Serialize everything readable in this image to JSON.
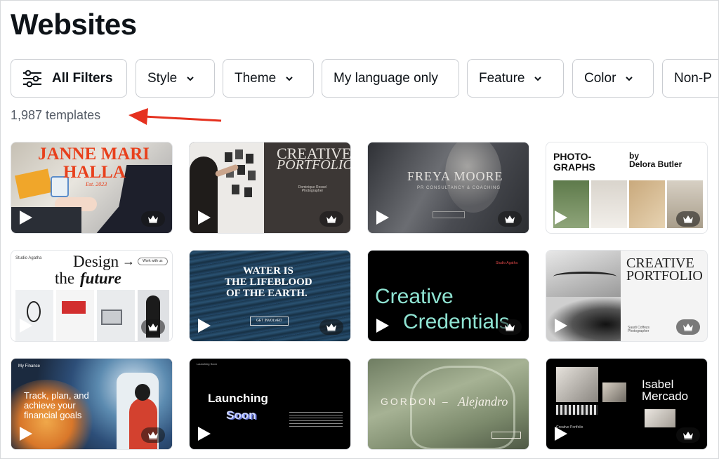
{
  "page": {
    "title": "Websites"
  },
  "filters": {
    "all": "All Filters",
    "style": "Style",
    "theme": "Theme",
    "language": "My language only",
    "feature": "Feature",
    "color": "Color",
    "nonp": "Non-P"
  },
  "result_count": "1,987 templates",
  "icons": {
    "filters": "sliders-icon",
    "chevron": "chevron-down-icon",
    "arrow": "red-arrow-icon",
    "play": "play-icon",
    "crown": "crown-icon"
  },
  "colors": {
    "accent_arrow": "#e5311f"
  },
  "templates": {
    "t1": {
      "line1": "JANNE MARI",
      "line2": "HALLA",
      "sub": "Est. 2023"
    },
    "t2": {
      "title1": "CREATIVE",
      "title2": "PORTFOLIO",
      "caption": "Dominique Rossel Photographer"
    },
    "t3": {
      "title": "FREYA MOORE",
      "sub": "PR CONSULTANCY & COACHING"
    },
    "t4": {
      "left": "PHOTO-GRAPHS",
      "by": "by",
      "name": "Delora Butler"
    },
    "t5": {
      "brand": "Studio Agatha",
      "line1": "Design",
      "line2": "the",
      "line3": "future",
      "button": "Work with us"
    },
    "t6": {
      "line1": "WATER IS",
      "line2": "THE LIFEBLOOD",
      "line3": "OF THE EARTH.",
      "button": "GET INVOLVED"
    },
    "t7": {
      "brand": "Studio Agatha",
      "line1": "Creative",
      "line2": "Credentials"
    },
    "t8": {
      "title1": "CREATIVE",
      "title2": "PORTFOLIO",
      "caption": "Saudi Coffeys Photographer"
    },
    "t9": {
      "brand": "My Finance",
      "line1": "Track, plan, and",
      "line2": "achieve your",
      "line3": "financial goals"
    },
    "t10": {
      "brand": "Launching Soon",
      "text1": "Launching",
      "text2": "Soon"
    },
    "t11": {
      "title": "GORDON –",
      "script": "Alejandro"
    },
    "t12": {
      "line1": "Isabel",
      "line2": "Mercado",
      "caption": "Creative Portfolio"
    }
  }
}
